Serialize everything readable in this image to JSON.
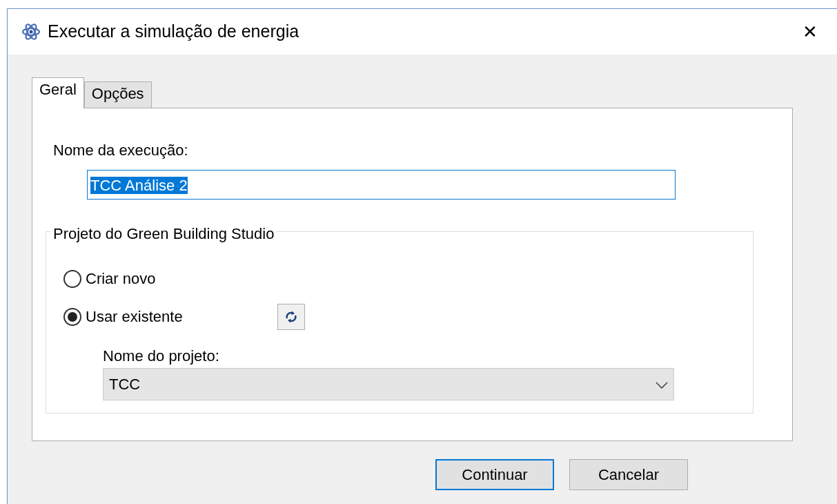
{
  "window": {
    "title": "Executar a simulação de energia",
    "close": "✕"
  },
  "tabs": [
    {
      "label": "Geral",
      "selected": true
    },
    {
      "label": "Opções",
      "selected": false
    }
  ],
  "run_name": {
    "label": "Nome da execução:",
    "value": "TCC Análise 2",
    "text_selected": true
  },
  "group": {
    "title": "Projeto do Green Building Studio",
    "options": [
      {
        "label": "Criar novo",
        "selected": false
      },
      {
        "label": "Usar existente",
        "selected": true
      }
    ],
    "project": {
      "label": "Nome do projeto:",
      "value": "TCC"
    }
  },
  "buttons": [
    {
      "label": "Continuar",
      "default": true
    },
    {
      "label": "Cancelar",
      "default": false
    }
  ]
}
